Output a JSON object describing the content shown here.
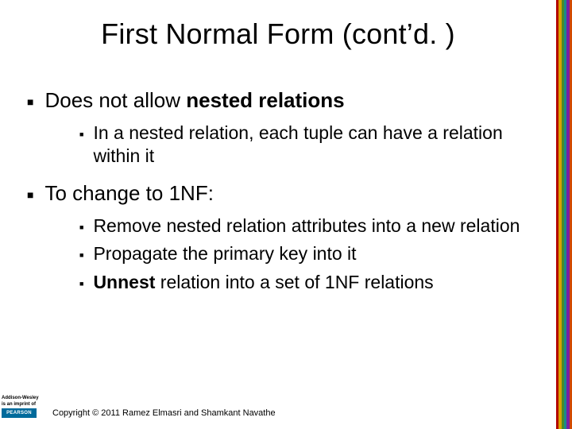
{
  "title": "First Normal Form (cont’d. )",
  "bullets": {
    "b1_pre": "Does not allow ",
    "b1_bold": "nested relations",
    "b1_post": "",
    "b1_1": "In a nested relation, each tuple can have a relation within it",
    "b2": "To change to 1NF:",
    "b2_1": "Remove nested relation attributes into a new relation",
    "b2_2": "Propagate the primary key into it",
    "b2_3_bold": "Unnest",
    "b2_3_rest": " relation into a set of 1NF relations"
  },
  "footer": {
    "aw_line1": "Addison-Wesley",
    "aw_line2": "is an imprint of",
    "pearson": "PEARSON",
    "copyright": "Copyright © 2011 Ramez Elmasri and Shamkant Navathe"
  }
}
